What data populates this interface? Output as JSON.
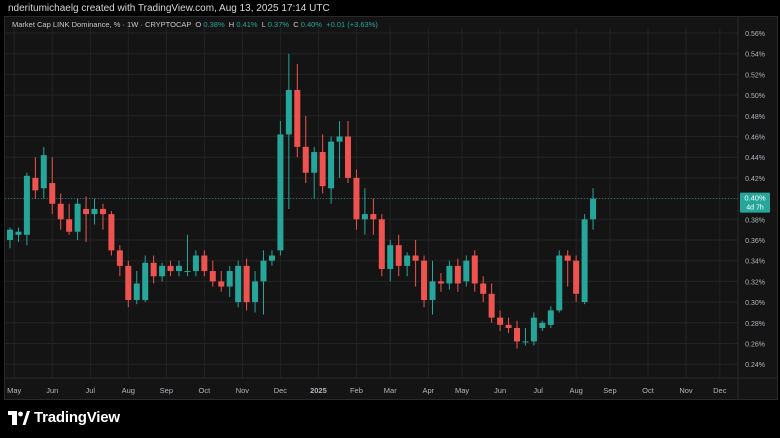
{
  "header": {
    "credit": "nderitumichaelg created with TradingView.com, Aug 13, 2025 17:14 UTC"
  },
  "legend": {
    "symbol": "Market Cap LINK Dominance, % · 1W · CRYPTOCAP",
    "o_label": "O",
    "o_value": "0.38%",
    "h_label": "H",
    "h_value": "0.41%",
    "l_label": "L",
    "l_value": "0.37%",
    "c_label": "C",
    "c_value": "0.40%",
    "change": "+0.01 (+3.63%)"
  },
  "brand": {
    "name": "TradingView",
    "logo_icon": "tradingview-logo-icon"
  },
  "colors": {
    "up": "#26a69a",
    "down": "#ef5350",
    "background": "#141414",
    "grid": "#232323",
    "text": "#b2b5be"
  },
  "chart_data": {
    "type": "candlestick",
    "symbol": "Market Cap LINK Dominance, % · 1W · CRYPTOCAP",
    "interval": "1W",
    "unit": "%",
    "ylim": [
      0.225,
      0.565
    ],
    "y_ticks": [
      "0.56%",
      "0.54%",
      "0.52%",
      "0.50%",
      "0.48%",
      "0.46%",
      "0.44%",
      "0.42%",
      "0.40%",
      "0.38%",
      "0.36%",
      "0.34%",
      "0.32%",
      "0.30%",
      "0.28%",
      "0.26%",
      "0.24%"
    ],
    "x_ticks": [
      {
        "label": "May",
        "i": 0.5
      },
      {
        "label": "Jun",
        "i": 5
      },
      {
        "label": "Jul",
        "i": 9.5
      },
      {
        "label": "Aug",
        "i": 14
      },
      {
        "label": "Sep",
        "i": 18.5
      },
      {
        "label": "Oct",
        "i": 23
      },
      {
        "label": "Nov",
        "i": 27.5
      },
      {
        "label": "Dec",
        "i": 32
      },
      {
        "label": "2025",
        "i": 36.5
      },
      {
        "label": "Feb",
        "i": 41
      },
      {
        "label": "Mar",
        "i": 45
      },
      {
        "label": "Apr",
        "i": 49.5
      },
      {
        "label": "May",
        "i": 53.5
      },
      {
        "label": "Jun",
        "i": 58
      },
      {
        "label": "Jul",
        "i": 62.5
      },
      {
        "label": "Aug",
        "i": 67
      },
      {
        "label": "Sep",
        "i": 71
      },
      {
        "label": "Oct",
        "i": 75.5
      },
      {
        "label": "Nov",
        "i": 80
      },
      {
        "label": "Dec",
        "i": 84
      }
    ],
    "last_price_label": "0.40%",
    "countdown_label": "4d 7h",
    "last_price": 0.4,
    "candles": [
      {
        "o": 0.36,
        "h": 0.372,
        "l": 0.352,
        "c": 0.37
      },
      {
        "o": 0.365,
        "h": 0.372,
        "l": 0.358,
        "c": 0.368
      },
      {
        "o": 0.365,
        "h": 0.425,
        "l": 0.355,
        "c": 0.422
      },
      {
        "o": 0.42,
        "h": 0.44,
        "l": 0.4,
        "c": 0.408
      },
      {
        "o": 0.41,
        "h": 0.45,
        "l": 0.4,
        "c": 0.442
      },
      {
        "o": 0.415,
        "h": 0.44,
        "l": 0.385,
        "c": 0.395
      },
      {
        "o": 0.395,
        "h": 0.405,
        "l": 0.37,
        "c": 0.38
      },
      {
        "o": 0.38,
        "h": 0.395,
        "l": 0.365,
        "c": 0.368
      },
      {
        "o": 0.368,
        "h": 0.4,
        "l": 0.36,
        "c": 0.395
      },
      {
        "o": 0.39,
        "h": 0.402,
        "l": 0.358,
        "c": 0.385
      },
      {
        "o": 0.385,
        "h": 0.4,
        "l": 0.375,
        "c": 0.39
      },
      {
        "o": 0.39,
        "h": 0.395,
        "l": 0.37,
        "c": 0.385
      },
      {
        "o": 0.385,
        "h": 0.388,
        "l": 0.345,
        "c": 0.35
      },
      {
        "o": 0.35,
        "h": 0.355,
        "l": 0.325,
        "c": 0.335
      },
      {
        "o": 0.335,
        "h": 0.34,
        "l": 0.295,
        "c": 0.302
      },
      {
        "o": 0.302,
        "h": 0.33,
        "l": 0.298,
        "c": 0.318
      },
      {
        "o": 0.302,
        "h": 0.345,
        "l": 0.3,
        "c": 0.338
      },
      {
        "o": 0.338,
        "h": 0.345,
        "l": 0.318,
        "c": 0.325
      },
      {
        "o": 0.325,
        "h": 0.338,
        "l": 0.32,
        "c": 0.335
      },
      {
        "o": 0.335,
        "h": 0.34,
        "l": 0.325,
        "c": 0.33
      },
      {
        "o": 0.33,
        "h": 0.34,
        "l": 0.325,
        "c": 0.335
      },
      {
        "o": 0.33,
        "h": 0.365,
        "l": 0.325,
        "c": 0.33
      },
      {
        "o": 0.33,
        "h": 0.35,
        "l": 0.325,
        "c": 0.345
      },
      {
        "o": 0.345,
        "h": 0.35,
        "l": 0.325,
        "c": 0.33
      },
      {
        "o": 0.33,
        "h": 0.34,
        "l": 0.315,
        "c": 0.32
      },
      {
        "o": 0.32,
        "h": 0.33,
        "l": 0.31,
        "c": 0.315
      },
      {
        "o": 0.315,
        "h": 0.335,
        "l": 0.305,
        "c": 0.33
      },
      {
        "o": 0.3,
        "h": 0.34,
        "l": 0.295,
        "c": 0.335
      },
      {
        "o": 0.335,
        "h": 0.342,
        "l": 0.292,
        "c": 0.3
      },
      {
        "o": 0.3,
        "h": 0.33,
        "l": 0.29,
        "c": 0.32
      },
      {
        "o": 0.32,
        "h": 0.35,
        "l": 0.288,
        "c": 0.34
      },
      {
        "o": 0.34,
        "h": 0.35,
        "l": 0.335,
        "c": 0.345
      },
      {
        "o": 0.35,
        "h": 0.475,
        "l": 0.345,
        "c": 0.462
      },
      {
        "o": 0.462,
        "h": 0.54,
        "l": 0.39,
        "c": 0.505
      },
      {
        "o": 0.505,
        "h": 0.53,
        "l": 0.44,
        "c": 0.45
      },
      {
        "o": 0.45,
        "h": 0.48,
        "l": 0.415,
        "c": 0.425
      },
      {
        "o": 0.425,
        "h": 0.45,
        "l": 0.4,
        "c": 0.445
      },
      {
        "o": 0.445,
        "h": 0.462,
        "l": 0.405,
        "c": 0.412
      },
      {
        "o": 0.41,
        "h": 0.46,
        "l": 0.395,
        "c": 0.455
      },
      {
        "o": 0.455,
        "h": 0.475,
        "l": 0.42,
        "c": 0.46
      },
      {
        "o": 0.46,
        "h": 0.475,
        "l": 0.415,
        "c": 0.42
      },
      {
        "o": 0.42,
        "h": 0.428,
        "l": 0.37,
        "c": 0.38
      },
      {
        "o": 0.38,
        "h": 0.41,
        "l": 0.365,
        "c": 0.385
      },
      {
        "o": 0.385,
        "h": 0.4,
        "l": 0.365,
        "c": 0.38
      },
      {
        "o": 0.38,
        "h": 0.385,
        "l": 0.325,
        "c": 0.332
      },
      {
        "o": 0.332,
        "h": 0.36,
        "l": 0.32,
        "c": 0.355
      },
      {
        "o": 0.355,
        "h": 0.365,
        "l": 0.325,
        "c": 0.335
      },
      {
        "o": 0.335,
        "h": 0.348,
        "l": 0.325,
        "c": 0.345
      },
      {
        "o": 0.345,
        "h": 0.36,
        "l": 0.315,
        "c": 0.34
      },
      {
        "o": 0.34,
        "h": 0.345,
        "l": 0.295,
        "c": 0.302
      },
      {
        "o": 0.302,
        "h": 0.34,
        "l": 0.288,
        "c": 0.32
      },
      {
        "o": 0.32,
        "h": 0.328,
        "l": 0.31,
        "c": 0.318
      },
      {
        "o": 0.318,
        "h": 0.34,
        "l": 0.312,
        "c": 0.335
      },
      {
        "o": 0.335,
        "h": 0.342,
        "l": 0.31,
        "c": 0.318
      },
      {
        "o": 0.32,
        "h": 0.345,
        "l": 0.315,
        "c": 0.34
      },
      {
        "o": 0.345,
        "h": 0.35,
        "l": 0.31,
        "c": 0.318
      },
      {
        "o": 0.318,
        "h": 0.325,
        "l": 0.3,
        "c": 0.308
      },
      {
        "o": 0.308,
        "h": 0.318,
        "l": 0.28,
        "c": 0.285
      },
      {
        "o": 0.285,
        "h": 0.292,
        "l": 0.272,
        "c": 0.278
      },
      {
        "o": 0.278,
        "h": 0.285,
        "l": 0.27,
        "c": 0.275
      },
      {
        "o": 0.275,
        "h": 0.282,
        "l": 0.255,
        "c": 0.262
      },
      {
        "o": 0.262,
        "h": 0.275,
        "l": 0.258,
        "c": 0.262
      },
      {
        "o": 0.262,
        "h": 0.29,
        "l": 0.258,
        "c": 0.285
      },
      {
        "o": 0.275,
        "h": 0.282,
        "l": 0.272,
        "c": 0.28
      },
      {
        "o": 0.278,
        "h": 0.296,
        "l": 0.275,
        "c": 0.292
      },
      {
        "o": 0.292,
        "h": 0.35,
        "l": 0.29,
        "c": 0.345
      },
      {
        "o": 0.345,
        "h": 0.35,
        "l": 0.315,
        "c": 0.34
      },
      {
        "o": 0.34,
        "h": 0.345,
        "l": 0.3,
        "c": 0.308
      },
      {
        "o": 0.3,
        "h": 0.385,
        "l": 0.298,
        "c": 0.38
      },
      {
        "o": 0.38,
        "h": 0.41,
        "l": 0.37,
        "c": 0.4
      }
    ]
  }
}
